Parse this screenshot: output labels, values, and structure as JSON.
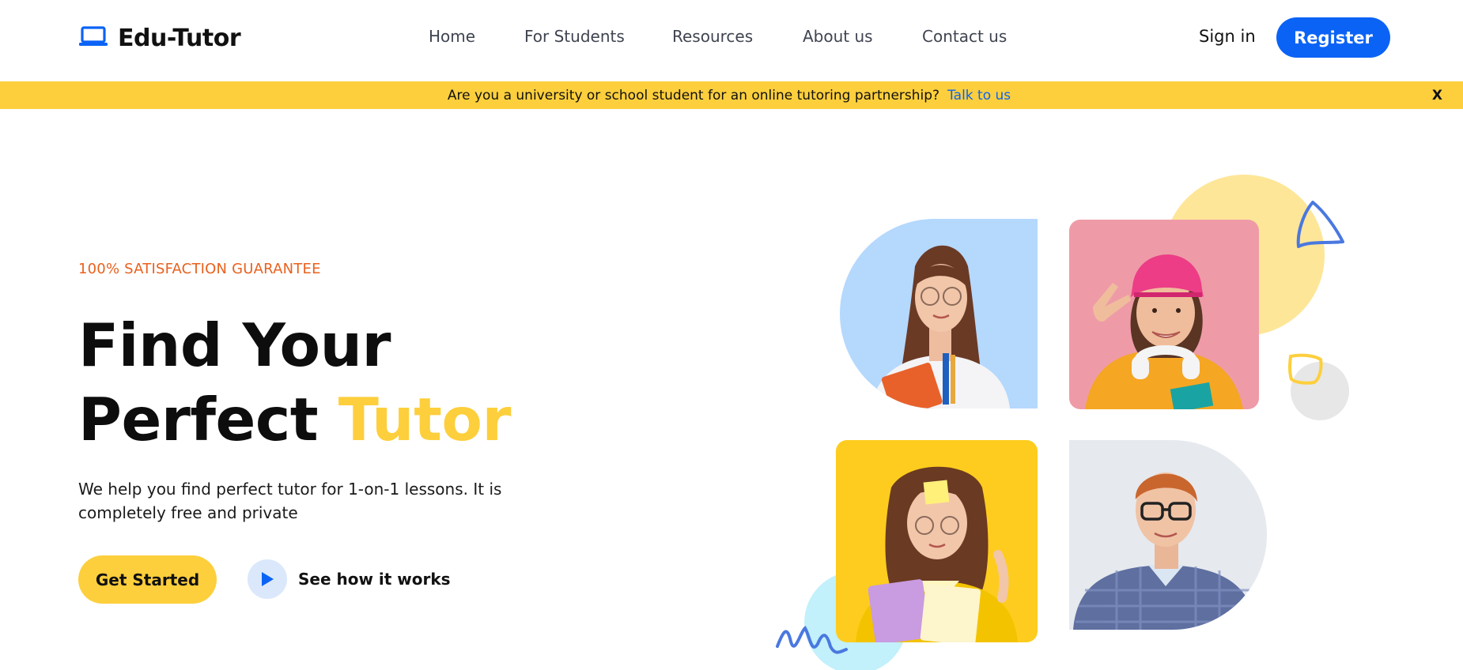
{
  "header": {
    "brand": "Edu-Tutor",
    "nav": [
      "Home",
      "For Students",
      "Resources",
      "About us",
      "Contact us"
    ],
    "sign_in": "Sign in",
    "register": "Register"
  },
  "banner": {
    "text": "Are you a university or school student for an online tutoring partnership?",
    "link": "Talk to us",
    "close": "X"
  },
  "hero": {
    "eyebrow": "100% SATISFACTION GUARANTEE",
    "title_line1": "Find Your",
    "title_line2_a": "Perfect",
    "title_line2_b": "Tutor",
    "description": "We help you find perfect tutor for 1-on-1 lessons. It is completely free and private",
    "primary_cta": "Get Started",
    "secondary_cta": "See how it works"
  },
  "colors": {
    "accent_blue": "#0b63f6",
    "accent_yellow": "#fdcf3c",
    "eyebrow_orange": "#e8611e",
    "tile_blue": "#b5d8fd",
    "tile_pink": "#ee9ba7",
    "tile_yellow": "#fecc1e",
    "tile_gray": "#e6e9ee"
  },
  "icons": {
    "logo": "laptop-icon",
    "play": "play-icon"
  }
}
